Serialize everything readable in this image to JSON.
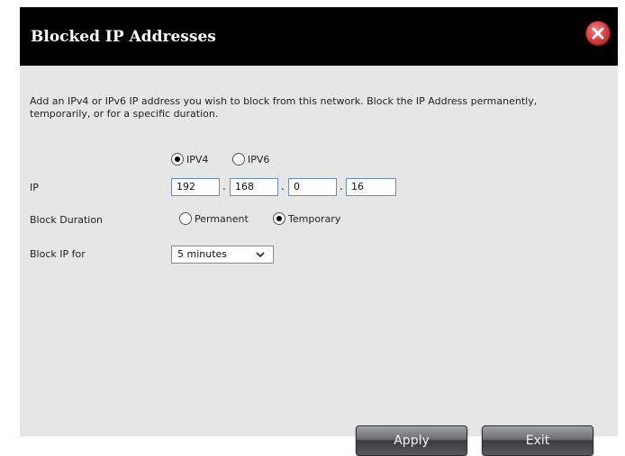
{
  "dialog": {
    "title": "Blocked IP Addresses",
    "description": "Add an IPv4 or IPv6 IP address you wish to block from this network. Block the IP Address permanently, temporarily, or for a specific duration."
  },
  "ip_version": {
    "options": [
      {
        "label": "IPV4",
        "selected": true
      },
      {
        "label": "IPV6",
        "selected": false
      }
    ]
  },
  "ip": {
    "label": "IP",
    "octets": [
      "192",
      "168",
      "0",
      "16"
    ],
    "separator": "."
  },
  "block_duration": {
    "label": "Block Duration",
    "options": [
      {
        "label": "Permanent",
        "selected": false
      },
      {
        "label": "Temporary",
        "selected": true
      }
    ]
  },
  "block_ip_for": {
    "label": "Block IP for",
    "selected": "5 minutes"
  },
  "buttons": {
    "apply": "Apply",
    "exit": "Exit"
  },
  "colors": {
    "titlebar": "#000000",
    "dialog_bg": "#e6e6e6",
    "close_button": "#d23c3c",
    "input_border": "#6b8cc9"
  }
}
